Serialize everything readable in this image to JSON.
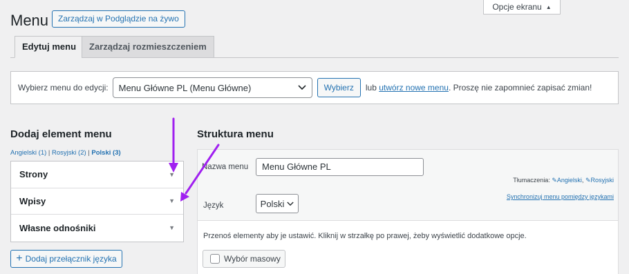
{
  "header": {
    "screen_options": "Opcje ekranu",
    "title": "Menu",
    "live_button": "Zarządzaj w Podglądzie na żywo"
  },
  "tabs": [
    {
      "label": "Edytuj menu"
    },
    {
      "label": "Zarządzaj rozmieszczeniem"
    }
  ],
  "select_menu": {
    "label": "Wybierz menu do edycji:",
    "selected": "Menu Główne PL (Menu Główne)",
    "button": "Wybierz",
    "or": "lub",
    "create_link": "utwórz nowe menu",
    "remember": ". Proszę nie zapomnieć zapisać zmian!"
  },
  "add_items": {
    "heading": "Dodaj element menu",
    "languages": {
      "english": "Angielski (1)",
      "russian": "Rosyjski (2)",
      "polish": "Polski (3)"
    },
    "sections": [
      {
        "label": "Strony"
      },
      {
        "label": "Wpisy"
      },
      {
        "label": "Własne odnośniki"
      }
    ],
    "lang_switch_button": "Dodaj przełącznik języka"
  },
  "structure": {
    "heading": "Struktura menu",
    "name_label": "Nazwa menu",
    "name_value": "Menu Główne PL",
    "translations_label": "Tłumaczenia:",
    "translation_en": "Angielski",
    "translation_ru": "Rosyjski",
    "sync_link": "Synchronizuj menu pomiędzy językami",
    "lang_label": "Język",
    "lang_value": "Polski",
    "instructions": "Przenoś elementy aby je ustawić. Kliknij w strzałkę po prawej, żeby wyświetlić dodatkowe opcje.",
    "bulk_select": "Wybór masowy"
  },
  "colors": {
    "accent": "#2271b1",
    "annotation_arrow": "#a020f0"
  }
}
